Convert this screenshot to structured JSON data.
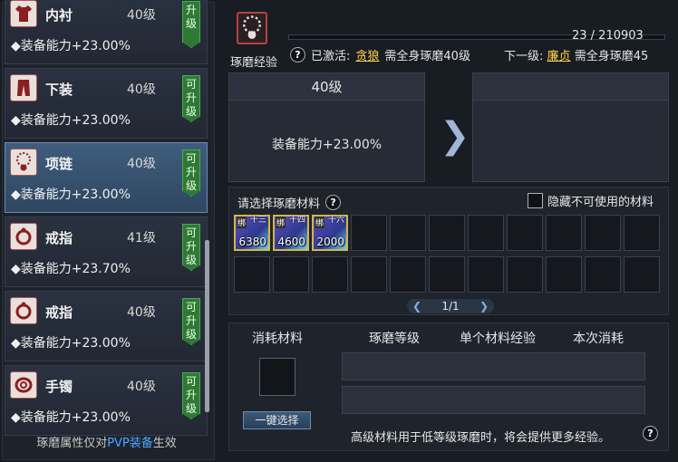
{
  "equipment_list": [
    {
      "name": "内衬",
      "level": "40级",
      "stat": "◆装备能力+23.00%",
      "badge": "升级",
      "icon": "shirt-icon",
      "selected": false
    },
    {
      "name": "下装",
      "level": "40级",
      "stat": "◆装备能力+23.00%",
      "badge": "可升级",
      "icon": "pants-icon",
      "selected": false
    },
    {
      "name": "项链",
      "level": "40级",
      "stat": "◆装备能力+23.00%",
      "badge": "可升级",
      "icon": "necklace-icon",
      "selected": true
    },
    {
      "name": "戒指",
      "level": "41级",
      "stat": "◆装备能力+23.70%",
      "badge": "可升级",
      "icon": "ring-icon",
      "selected": false
    },
    {
      "name": "戒指",
      "level": "40级",
      "stat": "◆装备能力+23.00%",
      "badge": "可升级",
      "icon": "ring-icon",
      "selected": false
    },
    {
      "name": "手镯",
      "level": "40级",
      "stat": "◆装备能力+23.00%",
      "badge": "可升级",
      "icon": "bracelet-icon",
      "selected": false
    }
  ],
  "left_footer": {
    "prefix": "琢磨属性仅对",
    "highlight": "PVP装备",
    "suffix": "生效"
  },
  "header": {
    "label": "琢磨经验",
    "xp_text": "23 / 210903",
    "xp_fraction": 0.0001,
    "activated_label": "已激活:",
    "activated_name": "贪狼",
    "activated_desc": "需全身琢磨40级",
    "next_label": "下一级:",
    "next_name": "廉贞",
    "next_desc": "需全身琢磨45"
  },
  "current": {
    "level": "40级",
    "stat": "装备能力+23.00%"
  },
  "materials": {
    "title": "请选择琢磨材料",
    "hide_unusable": "隐藏不可使用的材料",
    "filled": [
      {
        "tag": "绑",
        "rank": "十三",
        "count": "6380"
      },
      {
        "tag": "绑",
        "rank": "十四",
        "count": "4600"
      },
      {
        "tag": "绑",
        "rank": "十六",
        "count": "2000"
      }
    ],
    "page": "1/1"
  },
  "bottom": {
    "headers": [
      "消耗材料",
      "琢磨等级",
      "单个材料经验",
      "本次消耗"
    ],
    "one_click": "一键选择",
    "note": "高级材料用于低等级琢磨时，将会提供更多经验。"
  },
  "colors": {
    "accent": "#ffd34d",
    "pvp": "#4aa6ff",
    "badge": "#2e7a35"
  }
}
